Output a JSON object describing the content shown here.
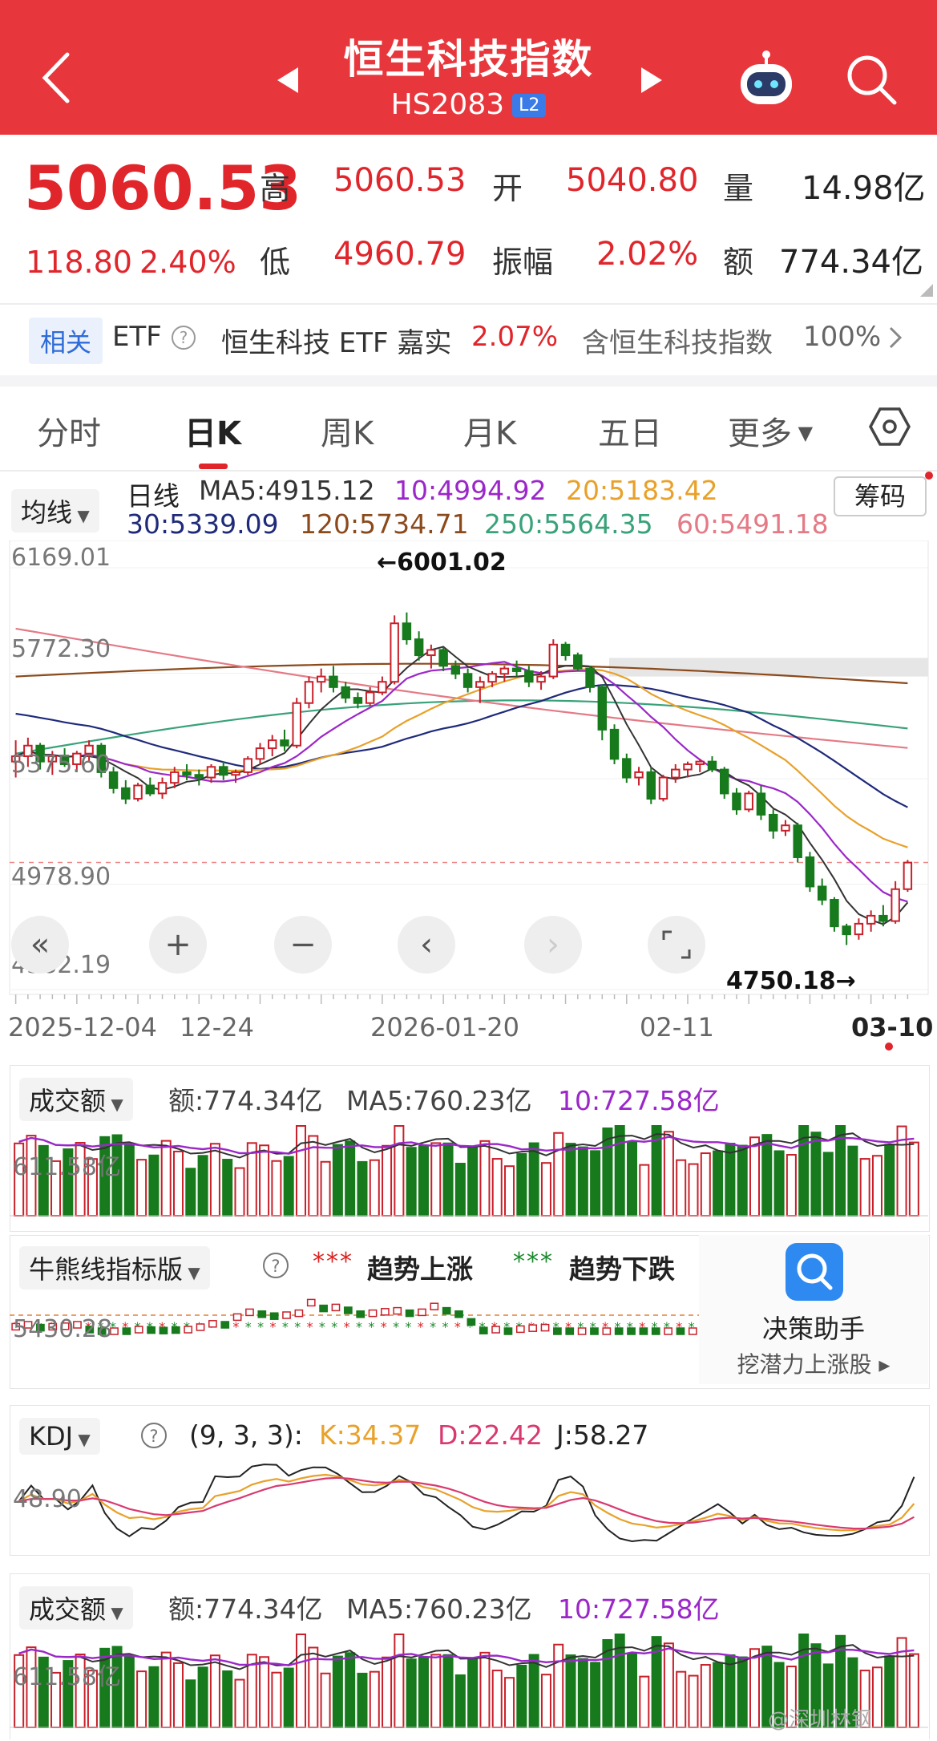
{
  "header": {
    "title": "恒生科技指数",
    "code": "HS2083",
    "level_badge": "L2",
    "icons": [
      "back-arrow-icon",
      "prev-index-icon",
      "next-index-icon",
      "robot-assistant-icon",
      "search-icon"
    ],
    "color": "#e8373c"
  },
  "quote": {
    "price": "5060.53",
    "change": "118.80",
    "change_pct": "2.40%",
    "high_label": "高",
    "high": "5060.53",
    "open_label": "开",
    "open": "5040.80",
    "volume_label": "量",
    "volume": "14.98亿",
    "low_label": "低",
    "low": "4960.79",
    "amplitude_label": "振幅",
    "amplitude": "2.02%",
    "turnover_label": "额",
    "turnover": "774.34亿"
  },
  "etf": {
    "tag": "相关",
    "type": "ETF",
    "name": "恒生科技 ETF 嘉实",
    "change_pct": "2.07%",
    "holding": "含恒生科技指数",
    "holding_pct": "100%"
  },
  "tabs": [
    {
      "label": "分时"
    },
    {
      "label": "日K",
      "active": true
    },
    {
      "label": "周K"
    },
    {
      "label": "月K"
    },
    {
      "label": "五日"
    },
    {
      "label": "更多"
    }
  ],
  "ma": {
    "selector": "均线",
    "kind": "日线",
    "ma5": "MA5:4915.12",
    "ma10": "10:4994.92",
    "ma20": "20:5183.42",
    "ma30": "30:5339.09",
    "ma120": "120:5734.71",
    "ma250": "250:5564.35",
    "ma60": "60:5491.18",
    "chip_button": "筹码"
  },
  "main_chart": {
    "y_labels": [
      "6169.01",
      "5772.30",
      "5375.60",
      "4978.90",
      "4582.19"
    ],
    "high_annotation": "←6001.02",
    "low_annotation": "4750.18→",
    "x_labels": [
      "2025-12-04",
      "12-24",
      "2026-01-20",
      "02-11",
      "03-10"
    ],
    "controls": [
      "zoom-out-icon",
      "plus-icon",
      "minus-icon",
      "chevron-left-icon",
      "chevron-right-icon",
      "fullscreen-icon"
    ]
  },
  "chart_data": {
    "type": "candlestick",
    "ylim": [
      4582.19,
      6169.01
    ],
    "y_ticks": [
      6169.01,
      5772.3,
      5375.6,
      4978.9,
      4582.19
    ],
    "x_ticks": [
      "2025-12-04",
      "12-24",
      "2026-01-20",
      "02-11",
      "03-10"
    ],
    "max_annotation": 6001.02,
    "min_annotation": 4750.18,
    "last_close": 5060.53,
    "candles": [
      [
        5440,
        5520,
        5380,
        5460
      ],
      [
        5460,
        5530,
        5420,
        5500
      ],
      [
        5500,
        5510,
        5410,
        5440
      ],
      [
        5440,
        5480,
        5390,
        5460
      ],
      [
        5460,
        5490,
        5420,
        5430
      ],
      [
        5430,
        5480,
        5400,
        5470
      ],
      [
        5470,
        5520,
        5440,
        5500
      ],
      [
        5500,
        5510,
        5380,
        5400
      ],
      [
        5400,
        5420,
        5320,
        5340
      ],
      [
        5340,
        5370,
        5280,
        5300
      ],
      [
        5300,
        5360,
        5290,
        5350
      ],
      [
        5350,
        5380,
        5310,
        5320
      ],
      [
        5320,
        5380,
        5300,
        5360
      ],
      [
        5360,
        5420,
        5340,
        5400
      ],
      [
        5400,
        5430,
        5370,
        5390
      ],
      [
        5390,
        5410,
        5350,
        5380
      ],
      [
        5380,
        5430,
        5360,
        5420
      ],
      [
        5420,
        5440,
        5370,
        5390
      ],
      [
        5390,
        5410,
        5360,
        5400
      ],
      [
        5400,
        5460,
        5390,
        5450
      ],
      [
        5450,
        5510,
        5430,
        5490
      ],
      [
        5490,
        5540,
        5460,
        5520
      ],
      [
        5520,
        5560,
        5480,
        5500
      ],
      [
        5500,
        5680,
        5490,
        5660
      ],
      [
        5660,
        5760,
        5640,
        5740
      ],
      [
        5740,
        5790,
        5700,
        5760
      ],
      [
        5760,
        5800,
        5700,
        5720
      ],
      [
        5720,
        5740,
        5660,
        5680
      ],
      [
        5680,
        5700,
        5640,
        5660
      ],
      [
        5660,
        5720,
        5650,
        5700
      ],
      [
        5700,
        5760,
        5690,
        5740
      ],
      [
        5740,
        5990,
        5730,
        5960
      ],
      [
        5960,
        6001,
        5880,
        5900
      ],
      [
        5900,
        5930,
        5820,
        5840
      ],
      [
        5840,
        5880,
        5790,
        5860
      ],
      [
        5860,
        5870,
        5780,
        5800
      ],
      [
        5800,
        5820,
        5750,
        5770
      ],
      [
        5770,
        5790,
        5700,
        5720
      ],
      [
        5720,
        5760,
        5660,
        5740
      ],
      [
        5740,
        5780,
        5720,
        5770
      ],
      [
        5770,
        5800,
        5740,
        5790
      ],
      [
        5790,
        5820,
        5760,
        5780
      ],
      [
        5780,
        5800,
        5720,
        5740
      ],
      [
        5740,
        5780,
        5710,
        5760
      ],
      [
        5760,
        5900,
        5750,
        5880
      ],
      [
        5880,
        5890,
        5820,
        5840
      ],
      [
        5840,
        5850,
        5780,
        5790
      ],
      [
        5790,
        5800,
        5700,
        5720
      ],
      [
        5720,
        5730,
        5520,
        5560
      ],
      [
        5560,
        5580,
        5430,
        5450
      ],
      [
        5450,
        5470,
        5360,
        5380
      ],
      [
        5380,
        5420,
        5350,
        5400
      ],
      [
        5400,
        5420,
        5280,
        5300
      ],
      [
        5300,
        5390,
        5290,
        5380
      ],
      [
        5380,
        5430,
        5360,
        5410
      ],
      [
        5410,
        5440,
        5380,
        5430
      ],
      [
        5430,
        5450,
        5400,
        5440
      ],
      [
        5440,
        5460,
        5400,
        5410
      ],
      [
        5410,
        5420,
        5300,
        5320
      ],
      [
        5320,
        5340,
        5240,
        5260
      ],
      [
        5260,
        5330,
        5250,
        5320
      ],
      [
        5320,
        5350,
        5220,
        5240
      ],
      [
        5240,
        5260,
        5150,
        5180
      ],
      [
        5180,
        5220,
        5160,
        5200
      ],
      [
        5200,
        5210,
        5060,
        5080
      ],
      [
        5080,
        5100,
        4950,
        4970
      ],
      [
        4970,
        5000,
        4900,
        4920
      ],
      [
        4920,
        4930,
        4800,
        4820
      ],
      [
        4820,
        4830,
        4750,
        4790
      ],
      [
        4790,
        4850,
        4770,
        4830
      ],
      [
        4830,
        4880,
        4800,
        4860
      ],
      [
        4860,
        4900,
        4820,
        4840
      ],
      [
        4840,
        4990,
        4830,
        4960
      ],
      [
        4960,
        5070,
        4950,
        5060
      ]
    ],
    "ma_lines": [
      {
        "name": "MA5",
        "color": "#333333",
        "last": 4915.12
      },
      {
        "name": "10",
        "color": "#9b27c9",
        "last": 4994.92
      },
      {
        "name": "20",
        "color": "#e8a12a",
        "last": 5183.42
      },
      {
        "name": "30",
        "color": "#1f2a7a",
        "last": 5339.09
      },
      {
        "name": "120",
        "color": "#8b4a1c",
        "last": 5734.71
      },
      {
        "name": "250",
        "color": "#3aa27a",
        "last": 5564.35
      },
      {
        "name": "60",
        "color": "#e47a86",
        "last": 5491.18
      }
    ],
    "up_color": "#c8202a",
    "down_color": "#177a1c"
  },
  "panels": {
    "turnover1": {
      "selector": "成交额",
      "amount": "额:774.34亿",
      "ma5": "MA5:760.23亿",
      "ma10": "10:727.58亿",
      "y_label": "611.58亿"
    },
    "bull_bear": {
      "selector": "牛熊线指标版",
      "help_icon": "help-icon",
      "up_legend": "趋势上涨",
      "down_legend": "趋势下跌",
      "y_label": "5430.28"
    },
    "assistant": {
      "title": "决策助手",
      "subtitle": "挖潜力上涨股"
    },
    "kdj": {
      "selector": "KDJ",
      "params": "(9, 3, 3):",
      "k": "K:34.37",
      "d": "D:22.42",
      "j": "J:58.27",
      "y_label": "48.90"
    },
    "turnover2": {
      "selector": "成交额",
      "amount": "额:774.34亿",
      "ma5": "MA5:760.23亿",
      "ma10": "10:727.58亿",
      "y_label": "611.58亿"
    },
    "watermark": "@深圳林钢"
  }
}
